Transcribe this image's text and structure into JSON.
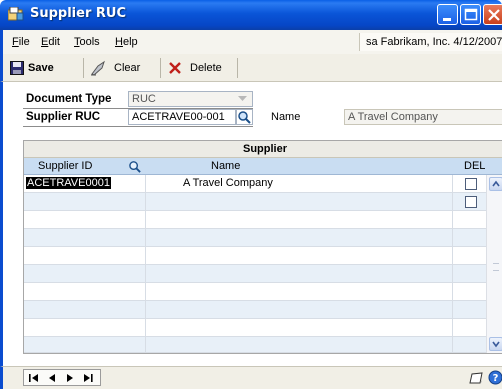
{
  "window": {
    "title": "Supplier RUC",
    "icon": "app-window-icon",
    "controls": [
      "minimize-icon",
      "maximize-icon",
      "close-icon"
    ]
  },
  "menu": {
    "items": [
      {
        "label": "File",
        "accel": "F"
      },
      {
        "label": "Edit",
        "accel": "E"
      },
      {
        "label": "Tools",
        "accel": "T"
      },
      {
        "label": "Help",
        "accel": "H"
      }
    ],
    "status": "sa  Fabrikam, Inc.  4/12/2007"
  },
  "toolbar": {
    "save_label": "Save",
    "clear_label": "Clear",
    "delete_label": "Delete"
  },
  "form": {
    "document_type_label": "Document Type",
    "document_type_value": "RUC",
    "supplier_ruc_label": "Supplier RUC",
    "supplier_ruc_value": "ACETRAVE00-001",
    "name_label": "Name",
    "name_value": "A Travel Company"
  },
  "grid": {
    "title": "Supplier",
    "columns": {
      "supplier_id": "Supplier ID",
      "name": "Name",
      "del": "DEL"
    },
    "rows": [
      {
        "supplier_id": "ACETRAVE0001",
        "name": "A Travel Company",
        "del": false,
        "selected": true
      },
      {
        "supplier_id": "",
        "name": "",
        "del": false,
        "selected": false
      }
    ],
    "empty_rows": 8
  },
  "colors": {
    "title_bar": "#0a55d8",
    "grid_header": "#c9ddf2",
    "grid_alt_row": "#e8f0f8"
  }
}
